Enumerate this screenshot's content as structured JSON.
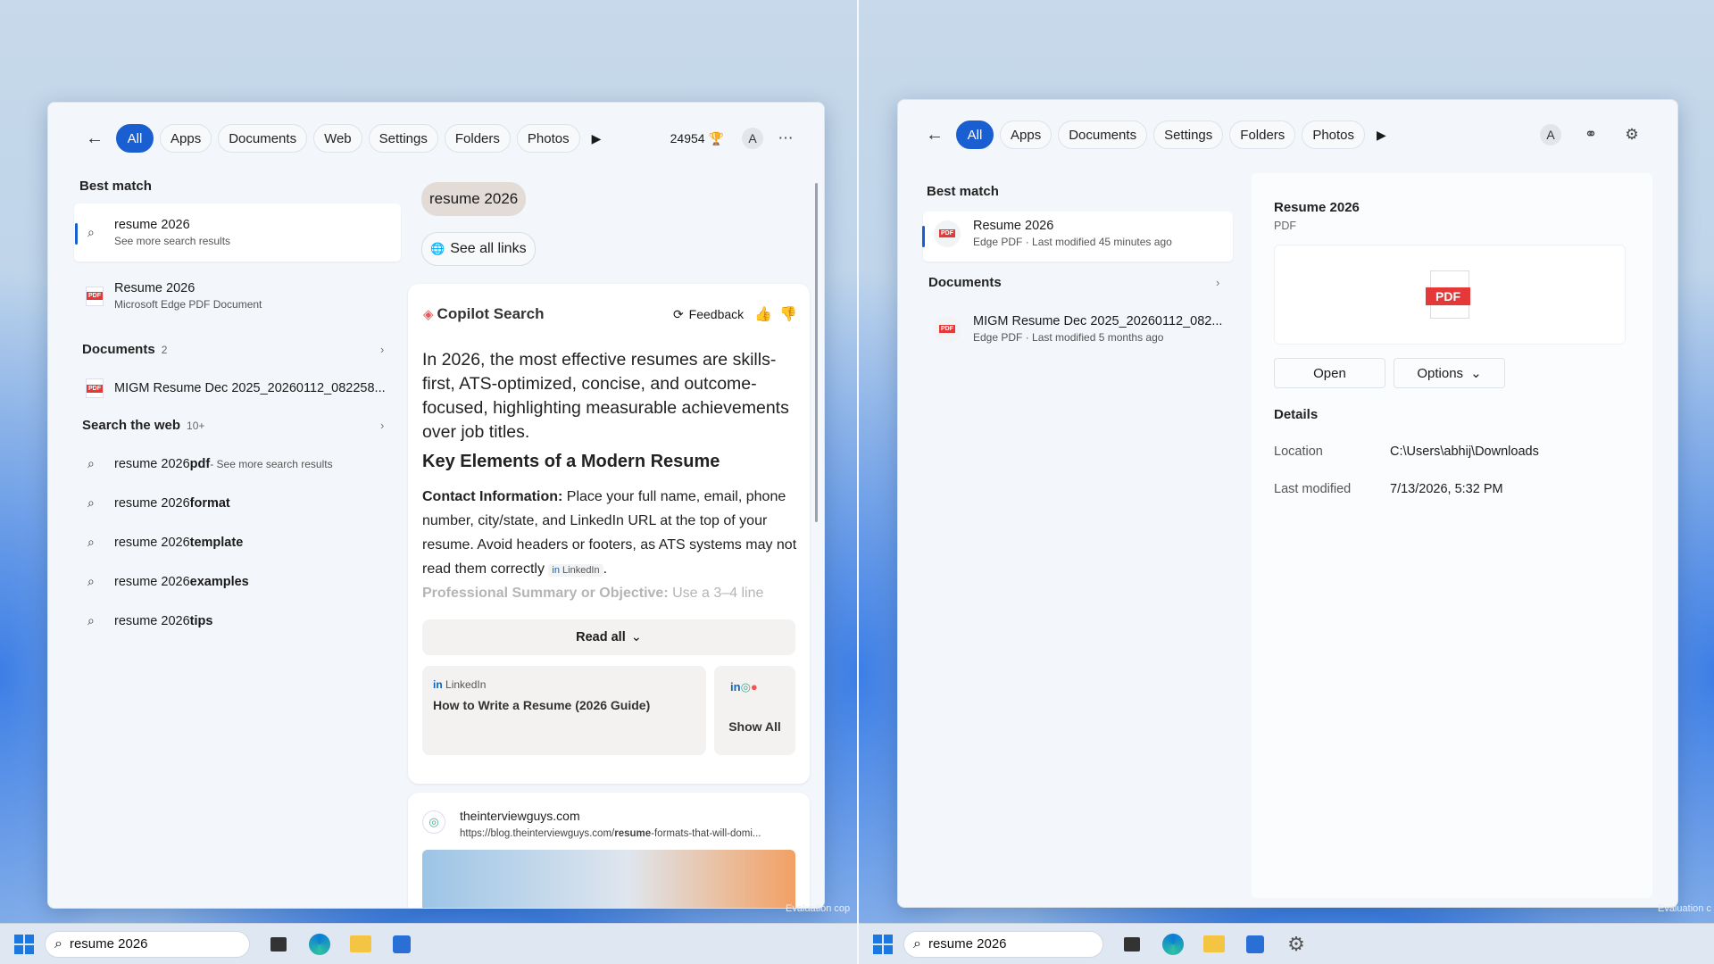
{
  "left": {
    "filters": [
      "All",
      "Apps",
      "Documents",
      "Web",
      "Settings",
      "Folders",
      "Photos"
    ],
    "rewards_points": "24954",
    "avatar_letter": "A",
    "best_match_header": "Best match",
    "best_match_items": [
      {
        "title": "resume 2026",
        "subtitle": "See more search results"
      },
      {
        "title": "Resume 2026",
        "subtitle": "Microsoft Edge PDF Document"
      }
    ],
    "documents_header": "Documents",
    "documents_count": "2",
    "documents_items": [
      {
        "title": "MIGM Resume Dec 2025_20260112_082258..."
      }
    ],
    "web_header": "Search the web",
    "web_count": "10+",
    "web_items": [
      {
        "pre": "resume 2026 ",
        "bold": "pdf",
        "suffix": " - See more search results"
      },
      {
        "pre": "resume 2026 ",
        "bold": "format",
        "suffix": ""
      },
      {
        "pre": "resume 2026 ",
        "bold": "template",
        "suffix": ""
      },
      {
        "pre": "resume 2026 ",
        "bold": "examples",
        "suffix": ""
      },
      {
        "pre": "resume 2026 ",
        "bold": "tips",
        "suffix": ""
      }
    ],
    "query_pill": "resume 2026",
    "see_all_links": "See all links",
    "copilot": {
      "title": "Copilot Search",
      "feedback": "Feedback",
      "summary": "In 2026, the most effective resumes are skills-first, ATS-optimized, concise, and outcome-focused, highlighting measurable achievements over job titles.",
      "heading": "Key Elements of a Modern Resume",
      "contact_label": "Contact Information:",
      "contact_text": " Place your full name, email, phone number, city/state, and LinkedIn URL at the top of your resume. Avoid headers or footers, as ATS systems may not read them correctly",
      "contact_source": "LinkedIn",
      "summary_label": "Professional Summary or Objective:",
      "summary_text": " Use a 3–4 line",
      "read_all": "Read all",
      "source_card_site": "LinkedIn",
      "source_card_title": "How to Write a Resume (2026 Guide)",
      "show_all": "Show All"
    },
    "web_result": {
      "site": "theinterviewguys.com",
      "url_pre": "https://blog.theinterviewguys.com/",
      "url_bold": "resume",
      "url_post": "-formats-that-will-domi..."
    },
    "watermark": "Evaluation cop",
    "taskbar_search": "resume 2026"
  },
  "right": {
    "filters": [
      "All",
      "Apps",
      "Documents",
      "Settings",
      "Folders",
      "Photos"
    ],
    "avatar_letter": "A",
    "best_match_header": "Best match",
    "best_match_items": [
      {
        "title": "Resume 2026",
        "subtitle": "Edge PDF · Last modified 45 minutes ago"
      }
    ],
    "documents_header": "Documents",
    "documents_items": [
      {
        "title": "MIGM Resume Dec 2025_20260112_082...",
        "subtitle": "Edge PDF · Last modified 5 months ago"
      }
    ],
    "preview": {
      "title": "Resume 2026",
      "type": "PDF",
      "pdf_badge": "PDF",
      "open": "Open",
      "options": "Options",
      "details_header": "Details",
      "location_label": "Location",
      "location_value": "C:\\Users\\abhij\\Downloads",
      "modified_label": "Last modified",
      "modified_value": "7/13/2026, 5:32 PM"
    },
    "watermark": "Evaluation c",
    "taskbar_search": "resume 2026"
  },
  "colors": {
    "accent": "#1a5fd1",
    "pdf_red": "#e53939"
  }
}
